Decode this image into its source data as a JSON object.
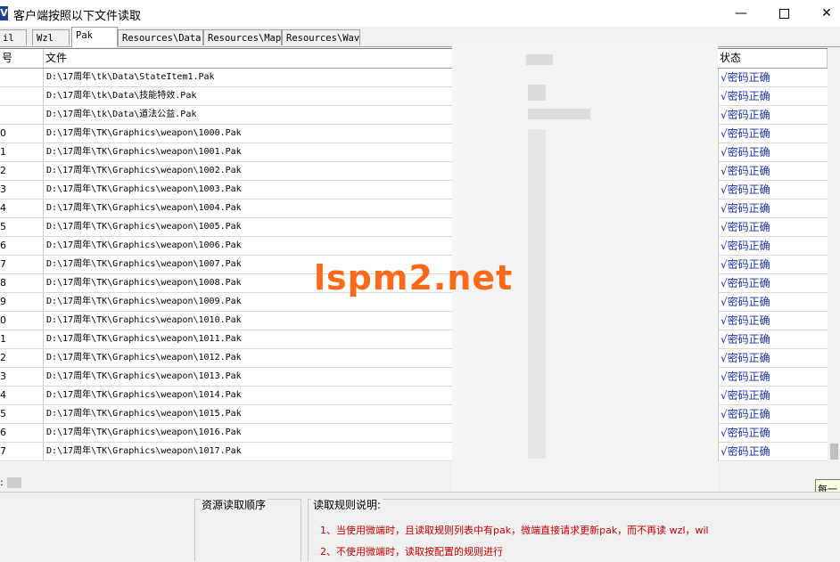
{
  "window": {
    "title": "客户端按照以下文件读取",
    "icon_letter": "V",
    "min_glyph": "—",
    "close_glyph": "✕"
  },
  "tabs": [
    {
      "label": "il"
    },
    {
      "label": "Wzl"
    },
    {
      "label": "Pak",
      "active": true
    },
    {
      "label": "Resources\\Data"
    },
    {
      "label": "Resources\\Map"
    },
    {
      "label": "Resources\\Wav"
    }
  ],
  "table": {
    "columns": {
      "index": "号",
      "file": "文件",
      "status": "状态"
    },
    "rows": [
      {
        "index": "",
        "file": "D:\\17周年\\tk\\Data\\StateItem1.Pak",
        "status": "√密码正确"
      },
      {
        "index": "",
        "file": "D:\\17周年\\tk\\Data\\技能特效.Pak",
        "status": "√密码正确"
      },
      {
        "index": "",
        "file": "D:\\17周年\\tk\\Data\\道法公益.Pak",
        "status": "√密码正确"
      },
      {
        "index": "0",
        "file": "D:\\17周年\\TK\\Graphics\\weapon\\1000.Pak",
        "status": "√密码正确"
      },
      {
        "index": "1",
        "file": "D:\\17周年\\TK\\Graphics\\weapon\\1001.Pak",
        "status": "√密码正确"
      },
      {
        "index": "2",
        "file": "D:\\17周年\\TK\\Graphics\\weapon\\1002.Pak",
        "status": "√密码正确"
      },
      {
        "index": "3",
        "file": "D:\\17周年\\TK\\Graphics\\weapon\\1003.Pak",
        "status": "√密码正确"
      },
      {
        "index": "4",
        "file": "D:\\17周年\\TK\\Graphics\\weapon\\1004.Pak",
        "status": "√密码正确"
      },
      {
        "index": "5",
        "file": "D:\\17周年\\TK\\Graphics\\weapon\\1005.Pak",
        "status": "√密码正确"
      },
      {
        "index": "6",
        "file": "D:\\17周年\\TK\\Graphics\\weapon\\1006.Pak",
        "status": "√密码正确"
      },
      {
        "index": "7",
        "file": "D:\\17周年\\TK\\Graphics\\weapon\\1007.Pak",
        "status": "√密码正确"
      },
      {
        "index": "8",
        "file": "D:\\17周年\\TK\\Graphics\\weapon\\1008.Pak",
        "status": "√密码正确"
      },
      {
        "index": "9",
        "file": "D:\\17周年\\TK\\Graphics\\weapon\\1009.Pak",
        "status": "√密码正确"
      },
      {
        "index": "0",
        "file": "D:\\17周年\\TK\\Graphics\\weapon\\1010.Pak",
        "status": "√密码正确"
      },
      {
        "index": "1",
        "file": "D:\\17周年\\TK\\Graphics\\weapon\\1011.Pak",
        "status": "√密码正确"
      },
      {
        "index": "2",
        "file": "D:\\17周年\\TK\\Graphics\\weapon\\1012.Pak",
        "status": "√密码正确"
      },
      {
        "index": "3",
        "file": "D:\\17周年\\TK\\Graphics\\weapon\\1013.Pak",
        "status": "√密码正确"
      },
      {
        "index": "4",
        "file": "D:\\17周年\\TK\\Graphics\\weapon\\1014.Pak",
        "status": "√密码正确"
      },
      {
        "index": "5",
        "file": "D:\\17周年\\TK\\Graphics\\weapon\\1015.Pak",
        "status": "√密码正确"
      },
      {
        "index": "6",
        "file": "D:\\17周年\\TK\\Graphics\\weapon\\1016.Pak",
        "status": "√密码正确"
      },
      {
        "index": "7",
        "file": "D:\\17周年\\TK\\Graphics\\weapon\\1017.Pak",
        "status": "√密码正确"
      }
    ]
  },
  "scrollbar_label": ":",
  "tooltip": "每一",
  "bottom": {
    "order_title": "资源读取顺序",
    "rules_title": "读取规则说明:",
    "rules": [
      "1、当使用微端时，且读取规则列表中有pak，微端直接请求更新pak，而不再读 wzl，wil",
      "2、不使用微端时，读取按配置的规则进行"
    ]
  },
  "watermark": "lspm2.net",
  "colors": {
    "status_text": "#1a2fa8",
    "rule_text": "#c00000",
    "watermark": "#ff6a1a"
  }
}
